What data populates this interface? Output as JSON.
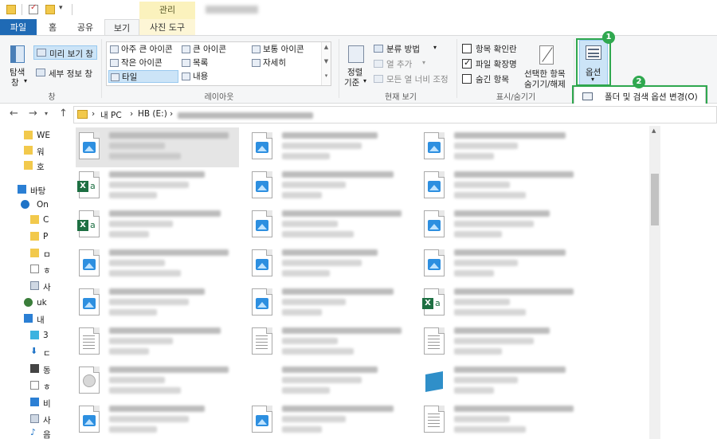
{
  "ribbon_tabs": {
    "contextual_group": "관리",
    "file": "파일",
    "home": "홈",
    "share": "공유",
    "view": "보기",
    "picture_tools": "사진 도구"
  },
  "panes": {
    "nav_pane": "탐색",
    "nav_pane_2": "창",
    "preview": "미리 보기 창",
    "details": "세부 정보 창",
    "group_label": "창"
  },
  "layout": {
    "items": [
      "아주 큰 아이콘",
      "큰 아이콘",
      "보통 아이콘",
      "작은 아이콘",
      "목록",
      "자세히",
      "타일",
      "내용"
    ],
    "selected": "타일",
    "group_label": "레이아웃"
  },
  "current_view": {
    "sort_1": "정렬",
    "sort_2": "기준",
    "group_by": "분류 방법",
    "add_columns": "열 추가",
    "fit_columns": "모든 열 너비 조정",
    "group_label": "현재 보기"
  },
  "show_hide": {
    "item_checkboxes": "항목 확인란",
    "item_checkboxes_checked": false,
    "extensions": "파일 확장명",
    "extensions_checked": true,
    "hidden_items": "숨긴 항목",
    "hidden_items_checked": false,
    "hide_selected_1": "선택한 항목",
    "hide_selected_2": "숨기기/해제",
    "group_label": "표시/숨기기"
  },
  "options": {
    "label": "옵션",
    "menu_item": "폴더 및 검색 옵션 변경(O)"
  },
  "annotations": {
    "badge_1": "1",
    "badge_2": "2",
    "color": "#2fa84f"
  },
  "address": {
    "this_pc": "내 PC",
    "drive": "HB (E:)"
  },
  "nav_items": [
    "WE",
    "워",
    "호",
    "바탕",
    "On",
    "C",
    "P",
    "ㅁ",
    "ㅎ",
    "사",
    "uk",
    "내",
    "3",
    "ㄷ",
    "동",
    "ㅎ",
    "비",
    "사",
    "음"
  ],
  "colors": {
    "accent": "#1f6ab5",
    "tab_highlight": "#fbf2bd",
    "selection": "#cce4f7"
  }
}
